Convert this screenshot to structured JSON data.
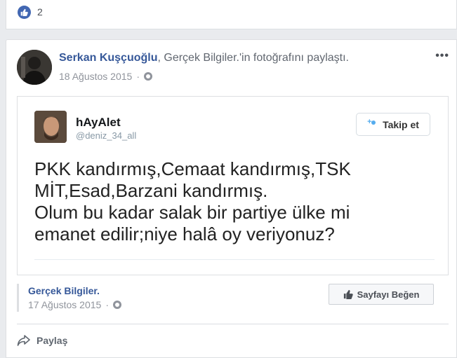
{
  "reactions": {
    "count": "2"
  },
  "post": {
    "author": "Serkan Kuşçuoğlu",
    "separator": ", ",
    "shared_page": "Gerçek Bilgiler.",
    "action_text": "'in fotoğrafını paylaştı.",
    "date": "18 Ağustos 2015",
    "date_sep": "·",
    "more_label": "•••"
  },
  "tweet": {
    "name": "hAyAlet",
    "handle": "@deniz_34_all",
    "follow_label": "Takip et",
    "lines": [
      "PKK kandırmış,Cemaat kandırmış,TSK",
      "MİT,Esad,Barzani kandırmış.",
      "Olum bu kadar salak bir partiye ülke mi",
      "emanet edilir;niye halâ oy veriyonuz?"
    ]
  },
  "page_attribution": {
    "name": "Gerçek Bilgiler.",
    "date": "17 Ağustos 2015",
    "date_sep": "·",
    "like_button_label": "Sayfayı Beğen"
  },
  "actions": {
    "share_label": "Paylaş"
  },
  "colors": {
    "link": "#365899",
    "accent": "#4267b2",
    "twitter": "#55acee"
  }
}
